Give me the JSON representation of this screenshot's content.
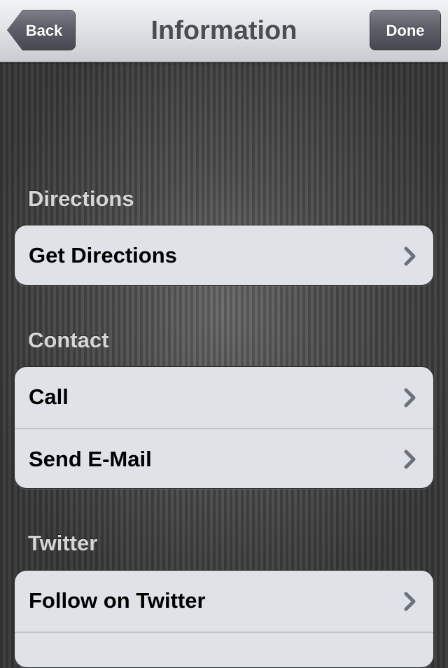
{
  "navbar": {
    "title": "Information",
    "back_label": "Back",
    "done_label": "Done"
  },
  "sections": [
    {
      "header": "Directions",
      "rows": [
        {
          "label": "Get Directions"
        }
      ]
    },
    {
      "header": "Contact",
      "rows": [
        {
          "label": "Call"
        },
        {
          "label": "Send E-Mail"
        }
      ]
    },
    {
      "header": "Twitter",
      "rows": [
        {
          "label": "Follow on Twitter"
        }
      ]
    }
  ],
  "colors": {
    "accent_button": "#5a5d66",
    "cell_background": "#dfe2e6",
    "chevron": "#6b707a"
  },
  "icons": {
    "disclosure": "chevron-right-icon"
  }
}
